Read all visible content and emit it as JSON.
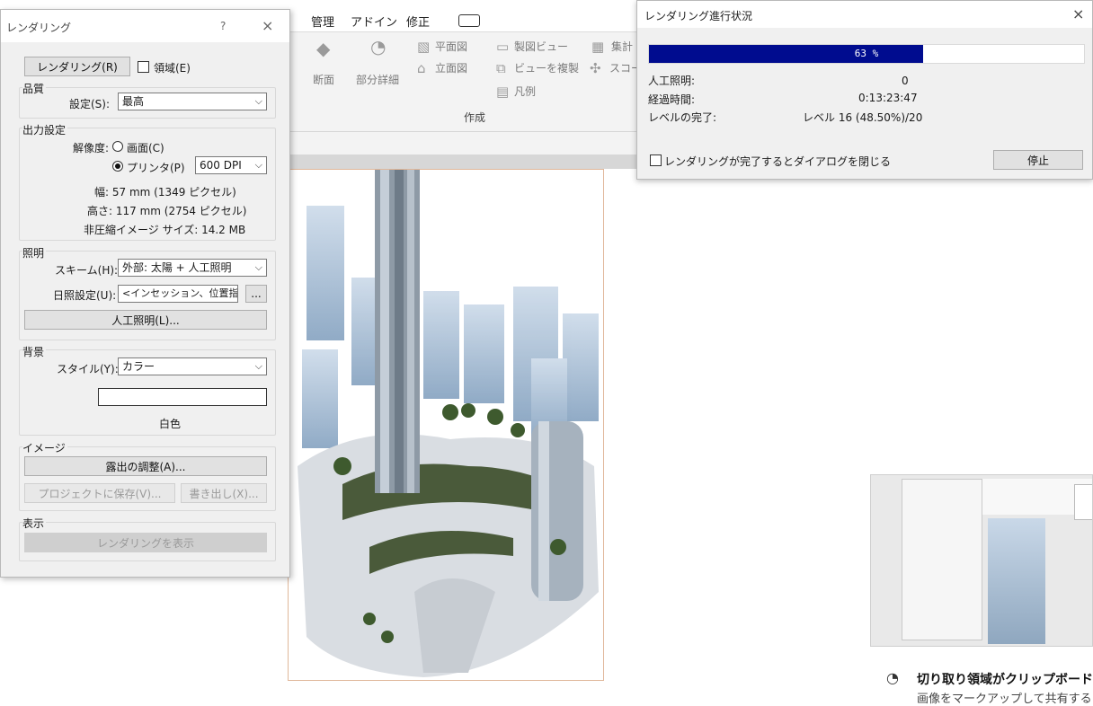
{
  "ribbon": {
    "tabs": [
      "管理",
      "アドイン",
      "修正"
    ],
    "tool_labels": {
      "section": "断面",
      "detail_part": "部分詳細",
      "plan": "平面図",
      "elevation": "立面図",
      "drafting_view": "製図ビュー",
      "duplicate_view": "ビューを複製",
      "legend": "凡例",
      "schedule": "集計",
      "scope": "スコー"
    },
    "panel_title": "作成"
  },
  "render_dialog": {
    "title": "レンダリング",
    "help": "?",
    "close": "×",
    "render_button": "レンダリング(R)",
    "region_label": "領域(E)",
    "quality": {
      "group": "品質",
      "setting_label": "設定(S):",
      "setting_value": "最高"
    },
    "output": {
      "group": "出力設定",
      "resolution_label": "解像度:",
      "screen_label": "画面(C)",
      "printer_label": "プリンタ(P)",
      "dpi_value": "600 DPI",
      "width": "幅:  57 mm (1349 ピクセル)",
      "height": "高さ:  117 mm (2754 ピクセル)",
      "size": "非圧縮イメージ サイズ: 14.2 MB"
    },
    "lighting": {
      "group": "照明",
      "scheme_label": "スキーム(H):",
      "scheme_value": "外部: 太陽 + 人工照明",
      "sun_label": "日照設定(U):",
      "sun_value": "<インセッション、位置指定",
      "sun_button": "...",
      "artificial_button": "人工照明(L)..."
    },
    "background": {
      "group": "背景",
      "style_label": "スタイル(Y):",
      "style_value": "カラー",
      "color_name": "白色",
      "color_hex": "#ffffff"
    },
    "image": {
      "group": "イメージ",
      "exposure_button": "露出の調整(A)...",
      "save_button": "プロジェクトに保存(V)...",
      "export_button": "書き出し(X)..."
    },
    "display": {
      "group": "表示",
      "show_button": "レンダリングを表示"
    }
  },
  "progress_dialog": {
    "title": "レンダリング進行状況",
    "close": "×",
    "percent_text": "63 %",
    "progress_fraction": 0.63,
    "artificial_light_label": "人工照明:",
    "artificial_light_value": "0",
    "elapsed_label": "経過時間:",
    "elapsed_value": "0:13:23:47",
    "level_label": "レベルの完了:",
    "level_value": "レベル 16 (48.50%)/20",
    "close_checkbox_label": "レンダリングが完了するとダイアログを閉じる",
    "stop_button": "停止"
  },
  "toast": {
    "title": "切り取り領域がクリップボードに",
    "subtitle": "画像をマークアップして共有する"
  },
  "colors": {
    "progress_fill": "#000c8f",
    "dialog_bg": "#f0f0f0",
    "viewport_border": "#e0b79a"
  }
}
